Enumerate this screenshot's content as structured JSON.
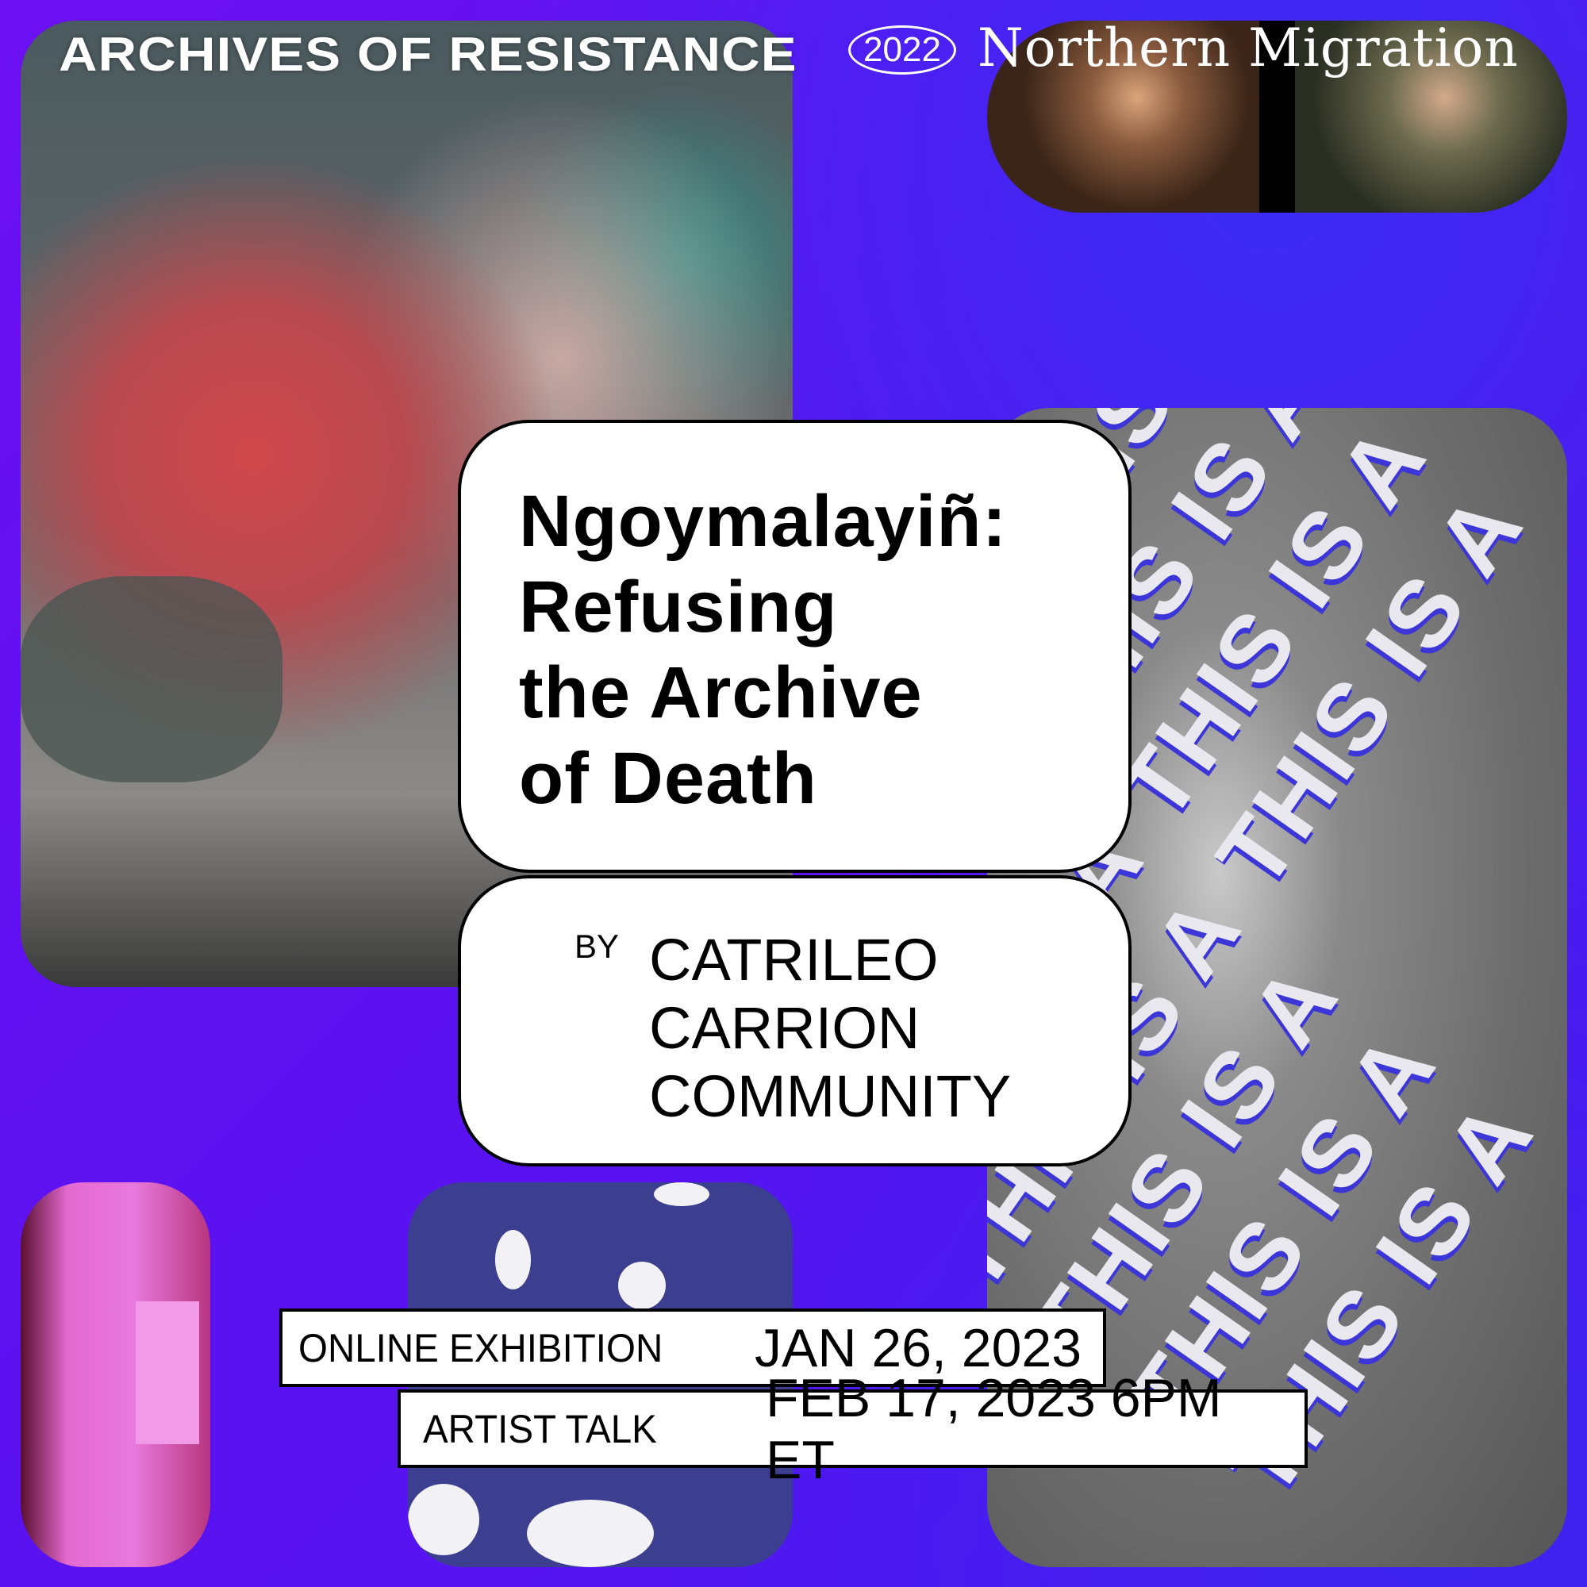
{
  "header": {
    "title": "ARCHIVES OF RESISTANCE",
    "year": "2022",
    "subtitle": "Northern Migration"
  },
  "event": {
    "title_lines": [
      "Ngoymalayiñ:",
      "Refusing",
      "the Archive",
      "of Death"
    ],
    "by_label": "BY",
    "artist_lines": [
      "CATRILEO",
      "CARRION",
      "COMMUNITY"
    ]
  },
  "schedule": [
    {
      "label": "ONLINE EXHIBITION",
      "value": "JAN 26, 2023"
    },
    {
      "label": "ARTIST TALK",
      "value": "FEB 17, 2023 6PM ET"
    }
  ],
  "artwork_text": "THIS IS A PRO-EPUPILLAN THIS IS A PRO-EPUPILLAN",
  "colors": {
    "background": "#5a12f0",
    "card": "#ffffff",
    "text": "#000000",
    "blue_panel": "#3c3f8f"
  }
}
